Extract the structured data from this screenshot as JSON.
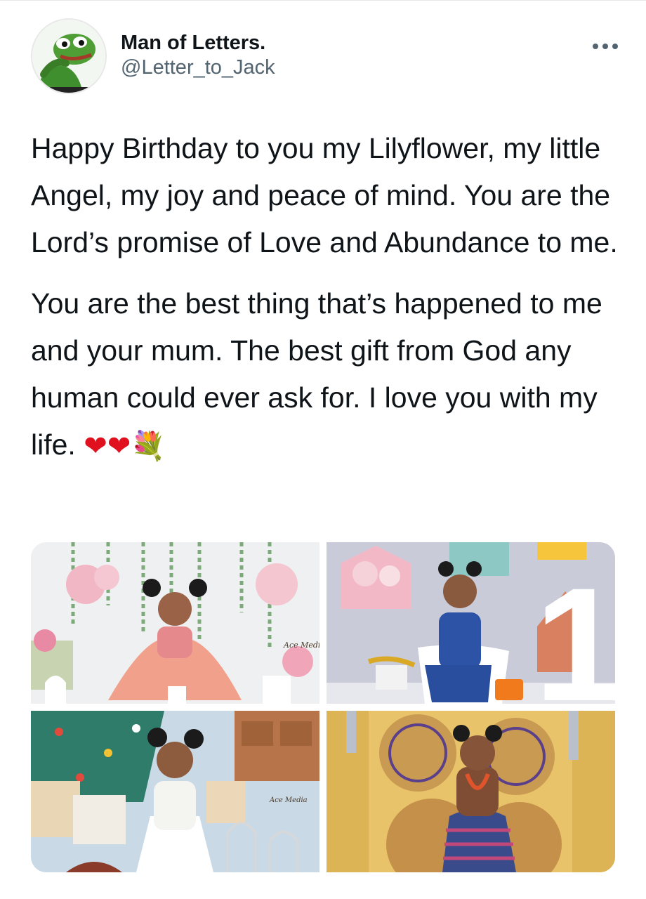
{
  "author": {
    "display_name": "Man of Letters.",
    "handle": "@Letter_to_Jack",
    "avatar_icon": "frog-avatar-icon"
  },
  "menu": {
    "icon": "more-options-icon"
  },
  "tweet": {
    "paragraph_1": "Happy Birthday to you my Lilyflower, my little Angel, my joy and peace of mind. You are the Lord’s promise of Love and Abundance to me.",
    "paragraph_2": "You are the best thing that’s happened to me and your mum. The best gift from God any human could ever ask for. I love you with my life.",
    "emojis": [
      "❤",
      "❤",
      "💐"
    ]
  },
  "media": {
    "photos": [
      {
        "alt": "photo-1",
        "watermark": "Ace Media"
      },
      {
        "alt": "photo-2",
        "numeral": "1"
      },
      {
        "alt": "photo-3",
        "watermark": "Ace Media"
      },
      {
        "alt": "photo-4"
      }
    ]
  },
  "colors": {
    "text": "#0f1419",
    "secondary": "#536471",
    "heart": "#e0101e"
  }
}
